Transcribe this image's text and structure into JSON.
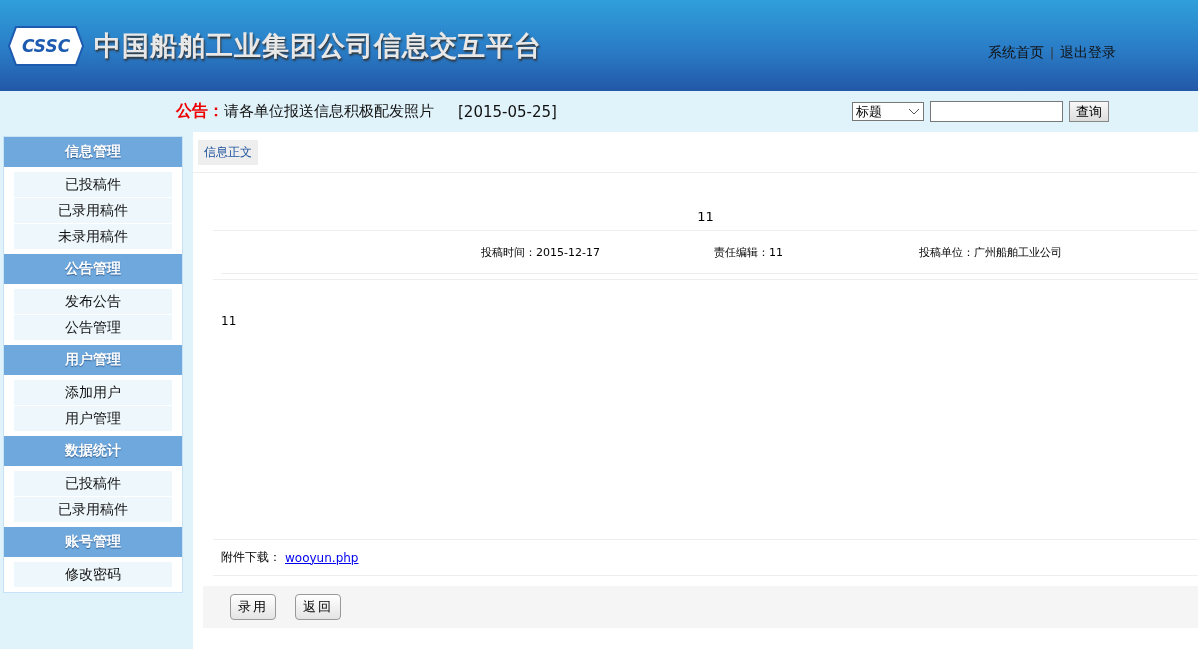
{
  "header": {
    "logo_text": "CSSC",
    "title": "中国船舶工业集团公司信息交互平台",
    "links": [
      "系统首页",
      "退出登录"
    ],
    "separator": "|"
  },
  "notice": {
    "label": "公告：",
    "text": "请各单位报送信息积极配发照片",
    "date": "[2015-05-25]"
  },
  "search": {
    "select_value": "标题",
    "button": "查询"
  },
  "sidebar": [
    {
      "title": "信息管理",
      "items": [
        "已投稿件",
        "已录用稿件",
        "未录用稿件"
      ]
    },
    {
      "title": "公告管理",
      "items": [
        "发布公告",
        "公告管理"
      ]
    },
    {
      "title": "用户管理",
      "items": [
        "添加用户",
        "用户管理"
      ]
    },
    {
      "title": "数据统计",
      "items": [
        "已投稿件",
        "已录用稿件"
      ]
    },
    {
      "title": "账号管理",
      "items": [
        "修改密码"
      ]
    }
  ],
  "tab": "信息正文",
  "article": {
    "title": "11",
    "meta": [
      "投稿时间：2015-12-17",
      "责任编辑：11",
      "投稿单位：广州船舶工业公司"
    ],
    "body": "11",
    "attachment_label": "附件下载：",
    "attachment_link": "wooyun.php"
  },
  "buttons": [
    "录用",
    "返回"
  ]
}
